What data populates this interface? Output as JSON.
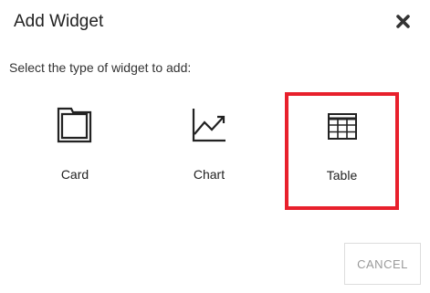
{
  "dialog": {
    "title": "Add Widget",
    "close_icon": "close-icon",
    "prompt": "Select the type of widget to add:",
    "options": [
      {
        "label": "Card",
        "icon": "folder-icon",
        "selected": false
      },
      {
        "label": "Chart",
        "icon": "line-chart-icon",
        "selected": false
      },
      {
        "label": "Table",
        "icon": "table-grid-icon",
        "selected": true
      }
    ],
    "cancel_label": "CANCEL",
    "selection_color": "#e8202c"
  }
}
